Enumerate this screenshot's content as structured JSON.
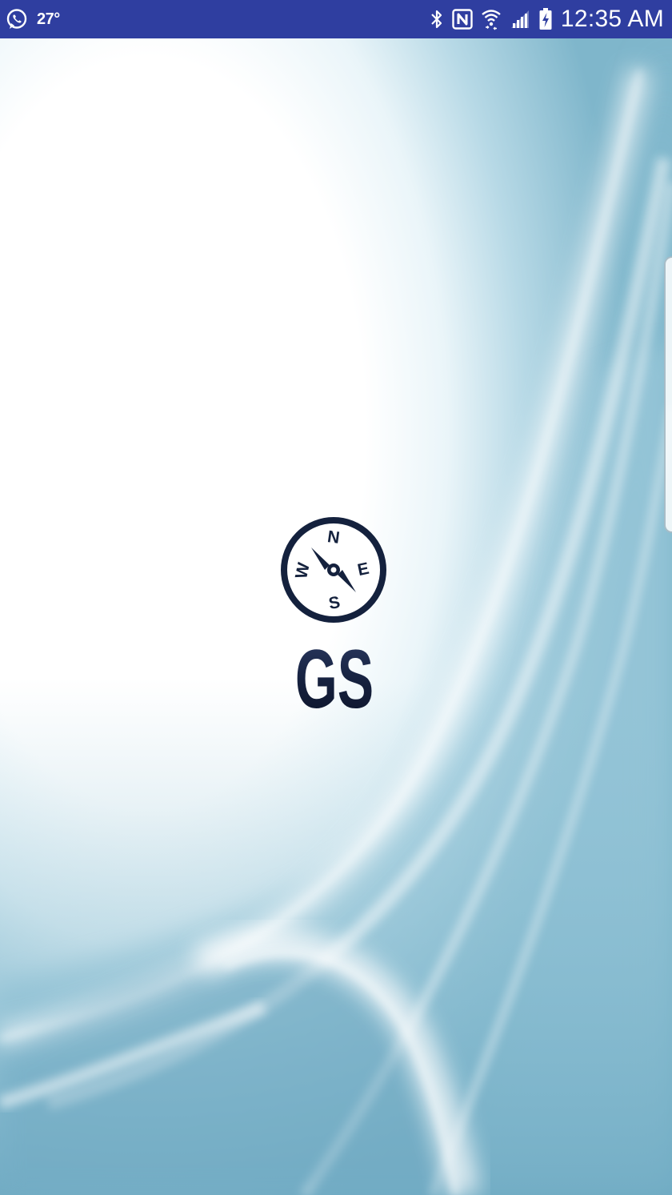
{
  "status_bar": {
    "temperature": "27°",
    "time": "12:35 AM",
    "left_icons": [
      "whatsapp-icon"
    ],
    "right_icons": [
      "bluetooth-icon",
      "nfc-icon",
      "wifi-icon",
      "signal-icon",
      "battery-charging-icon"
    ],
    "background_color": "#2f3ea0"
  },
  "splash": {
    "compass": {
      "north": "N",
      "east": "E",
      "south": "S",
      "west": "W"
    },
    "logo_text": "GS",
    "brand_color": "#14213d"
  }
}
